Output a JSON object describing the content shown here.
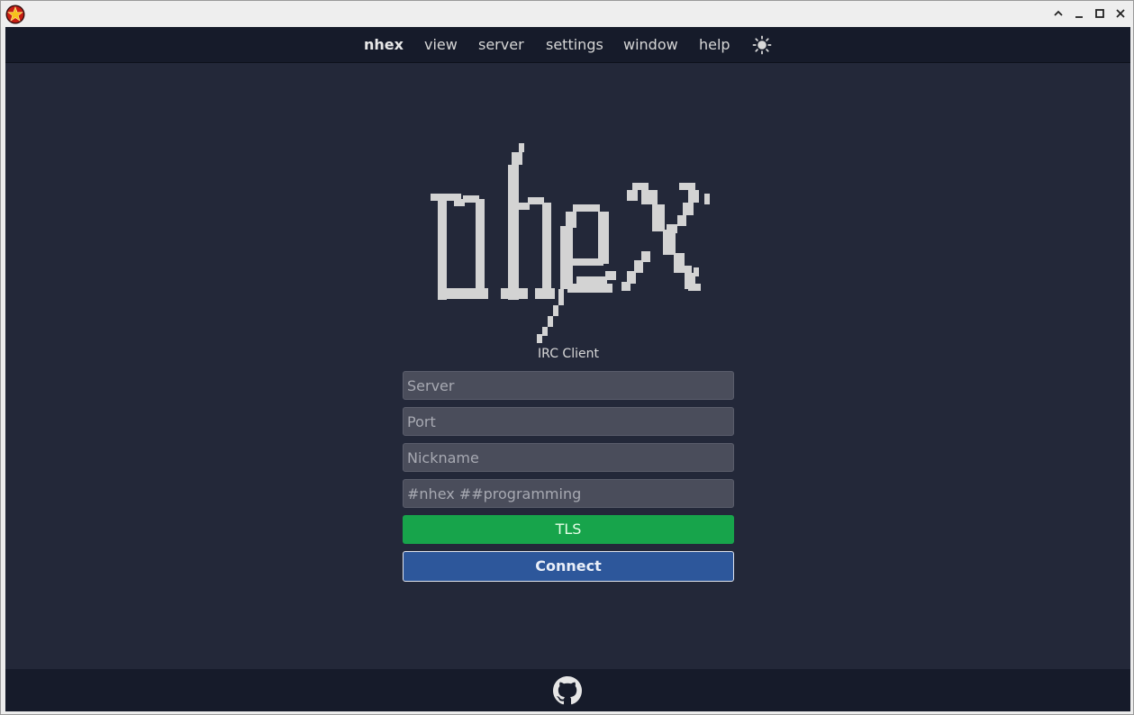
{
  "window": {
    "app_icon": "star-badge-icon",
    "controls": [
      "chevron-up-icon",
      "minimize-icon",
      "maximize-icon",
      "close-icon"
    ]
  },
  "menu": {
    "items": [
      {
        "label": "nhex"
      },
      {
        "label": "view"
      },
      {
        "label": "server"
      },
      {
        "label": "settings"
      },
      {
        "label": "window"
      },
      {
        "label": "help"
      }
    ],
    "theme_icon": "sun-icon"
  },
  "hero": {
    "logo_text": "nhex",
    "subtitle": "IRC Client"
  },
  "form": {
    "server_placeholder": "Server",
    "port_placeholder": "Port",
    "nickname_placeholder": "Nickname",
    "channels_placeholder": "#nhex ##programming",
    "tls_label": "TLS",
    "connect_label": "Connect"
  },
  "footer": {
    "icon": "github-icon"
  },
  "colors": {
    "background": "#232839",
    "bar": "#161b2a",
    "field": "#4a4d5b",
    "tls": "#17a44b",
    "connect": "#2d579b"
  }
}
